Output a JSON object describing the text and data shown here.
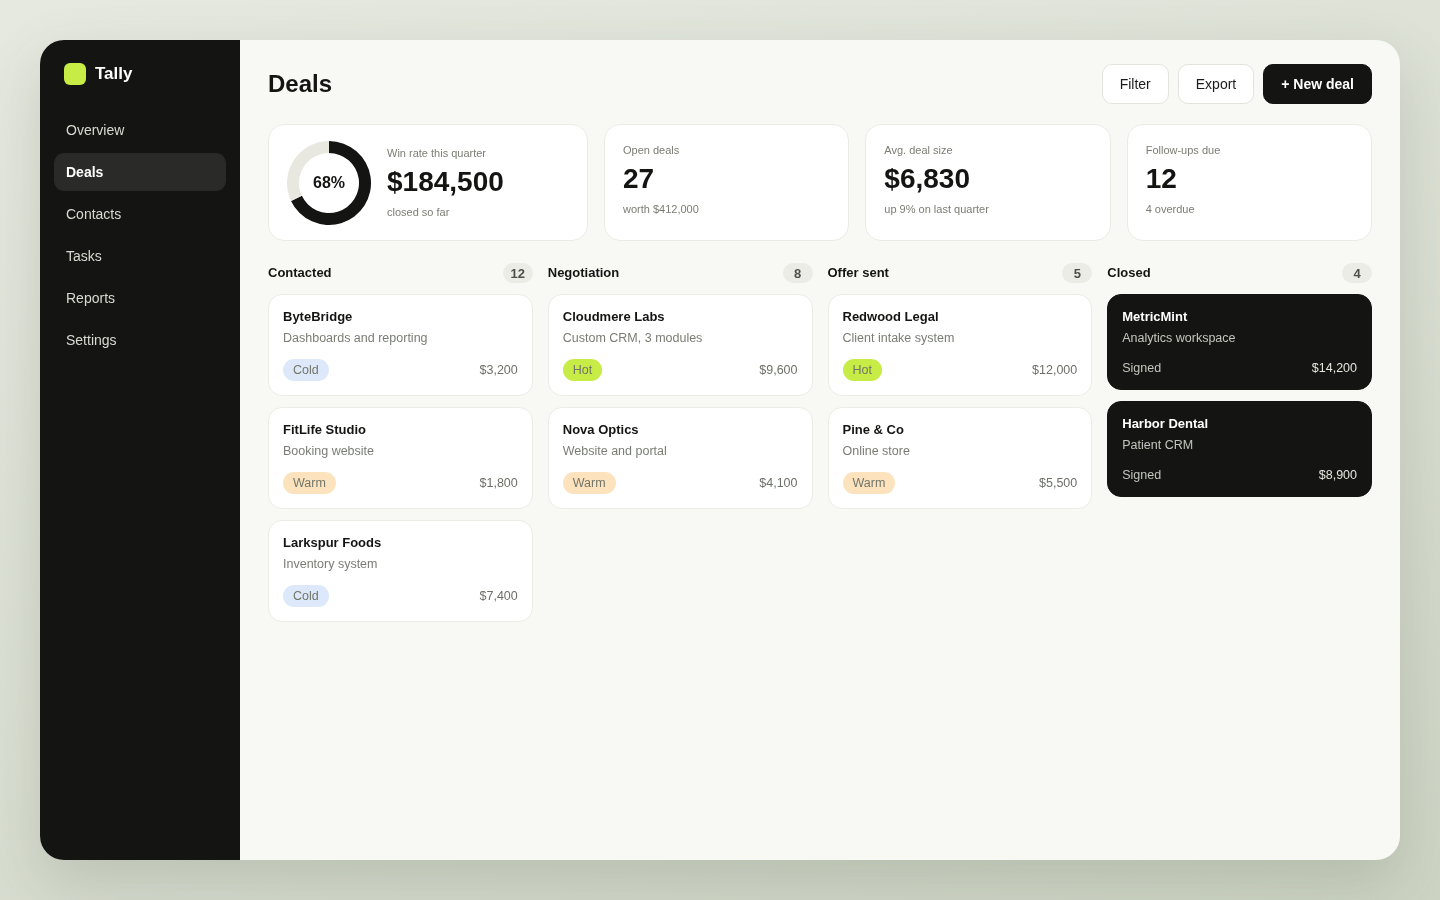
{
  "sidebar": {
    "brand": "Tally",
    "items": [
      {
        "label": "Overview",
        "selected": false
      },
      {
        "label": "Deals",
        "selected": true
      },
      {
        "label": "Contacts",
        "selected": false
      },
      {
        "label": "Tasks",
        "selected": false
      },
      {
        "label": "Reports",
        "selected": false
      },
      {
        "label": "Settings",
        "selected": false
      }
    ]
  },
  "header": {
    "title": "Deals",
    "buttons": [
      {
        "label": "Filter",
        "kind": "secondary"
      },
      {
        "label": "Export",
        "kind": "secondary"
      },
      {
        "label": "+ New deal",
        "kind": "primary"
      }
    ]
  },
  "stats": [
    {
      "kind": "donut",
      "chart_data": {
        "type": "donut",
        "values": [
          68,
          32
        ]
      },
      "center_label": "68%",
      "label": "Win rate this quarter",
      "value": "$184,500",
      "note": "closed so far"
    },
    {
      "kind": "plain",
      "label": "Open deals",
      "value": "27",
      "note": "worth $412,000"
    },
    {
      "kind": "plain",
      "label": "Avg. deal size",
      "value": "$6,830",
      "note": "up 9% on last quarter"
    },
    {
      "kind": "plain",
      "label": "Follow-ups due",
      "value": "12",
      "note": "4 overdue"
    }
  ],
  "board": {
    "columns": [
      {
        "title": "Contacted",
        "count": "12",
        "kind": "open",
        "cards": [
          {
            "name": "ByteBridge",
            "description": "Dashboards and reporting",
            "tag": {
              "label": "Cold",
              "color": "#dde9fb"
            },
            "amount": "$3,200"
          },
          {
            "name": "FitLife Studio",
            "description": "Booking website",
            "tag": {
              "label": "Warm",
              "color": "#fde3bd"
            },
            "amount": "$1,800"
          },
          {
            "name": "Larkspur Foods",
            "description": "Inventory system",
            "tag": {
              "label": "Cold",
              "color": "#dde9fb"
            },
            "amount": "$7,400"
          }
        ]
      },
      {
        "title": "Negotiation",
        "count": "8",
        "kind": "open",
        "cards": [
          {
            "name": "Cloudmere Labs",
            "description": "Custom CRM, 3 modules",
            "tag": {
              "label": "Hot",
              "color": "#c6ec45"
            },
            "amount": "$9,600"
          },
          {
            "name": "Nova Optics",
            "description": "Website and portal",
            "tag": {
              "label": "Warm",
              "color": "#fde3bd"
            },
            "amount": "$4,100"
          }
        ]
      },
      {
        "title": "Offer sent",
        "count": "5",
        "kind": "open",
        "cards": [
          {
            "name": "Redwood Legal",
            "description": "Client intake system",
            "tag": {
              "label": "Hot",
              "color": "#c6ec45"
            },
            "amount": "$12,000"
          },
          {
            "name": "Pine & Co",
            "description": "Online store",
            "tag": {
              "label": "Warm",
              "color": "#fde3bd"
            },
            "amount": "$5,500"
          }
        ]
      },
      {
        "title": "Closed",
        "count": "4",
        "kind": "closed",
        "cards": [
          {
            "name": "MetricMint",
            "description": "Analytics workspace",
            "status": "Signed",
            "amount": "$14,200"
          },
          {
            "name": "Harbor Dental",
            "description": "Patient CRM",
            "status": "Signed",
            "amount": "$8,900"
          }
        ]
      }
    ]
  }
}
